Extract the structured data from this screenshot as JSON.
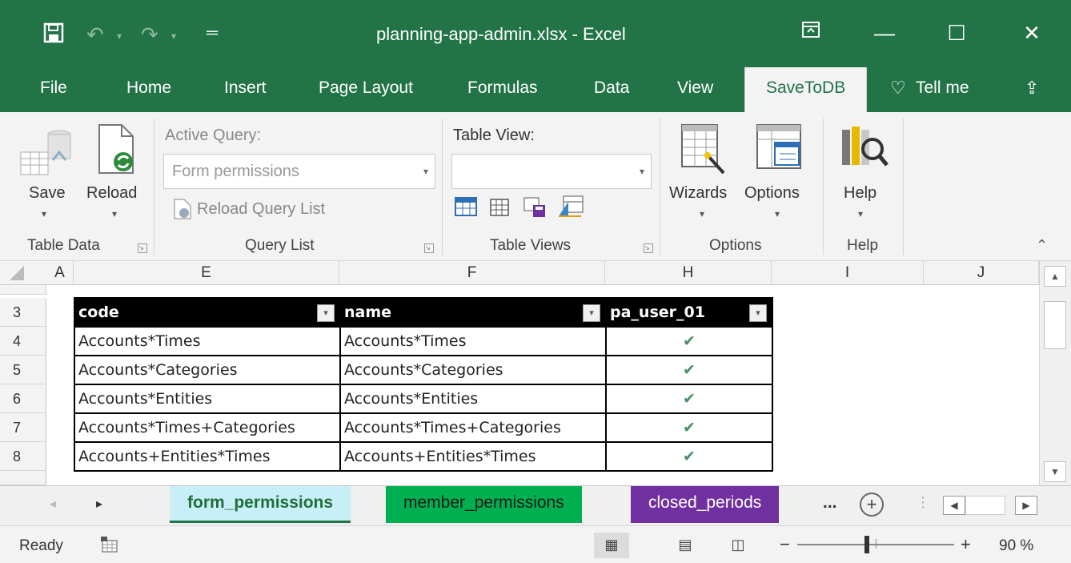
{
  "window": {
    "title": "planning-app-admin.xlsx  -  Excel"
  },
  "ribbon_tabs": [
    "File",
    "Home",
    "Insert",
    "Page Layout",
    "Formulas",
    "Data",
    "View",
    "SaveToDB",
    "Tell me"
  ],
  "active_tab": "SaveToDB",
  "ribbon": {
    "save_label": "Save",
    "reload_label": "Reload",
    "active_query_label": "Active Query:",
    "active_query_value": "Form permissions",
    "reload_query_list_label": "Reload Query List",
    "table_view_label": "Table View:",
    "table_view_value": "",
    "wizards_label": "Wizards",
    "options_label": "Options",
    "help_label": "Help",
    "groups": {
      "table_data": "Table Data",
      "query_list": "Query List",
      "table_views": "Table Views",
      "options": "Options",
      "help": "Help"
    }
  },
  "columns": [
    "A",
    "E",
    "F",
    "H",
    "I",
    "J"
  ],
  "rows": [
    "3",
    "4",
    "5",
    "6",
    "7",
    "8"
  ],
  "table": {
    "headers": [
      "code",
      "name",
      "pa_user_01"
    ],
    "rows": [
      {
        "code": "Accounts*Times",
        "name": "Accounts*Times",
        "check": "✔"
      },
      {
        "code": "Accounts*Categories",
        "name": "Accounts*Categories",
        "check": "✔"
      },
      {
        "code": "Accounts*Entities",
        "name": "Accounts*Entities",
        "check": "✔"
      },
      {
        "code": "Accounts*Times+Categories",
        "name": "Accounts*Times+Categories",
        "check": "✔"
      },
      {
        "code": "Accounts+Entities*Times",
        "name": "Accounts+Entities*Times",
        "check": "✔"
      }
    ]
  },
  "sheet_tabs": {
    "active": "form_permissions",
    "tab2": "member_permissions",
    "tab3": "closed_periods",
    "more": "..."
  },
  "status": {
    "ready": "Ready",
    "zoom": "90 %"
  },
  "colors": {
    "accent": "#227447",
    "tab_green": "#00b050",
    "tab_purple": "#7030a0",
    "tab_active": "#c8eef7"
  }
}
